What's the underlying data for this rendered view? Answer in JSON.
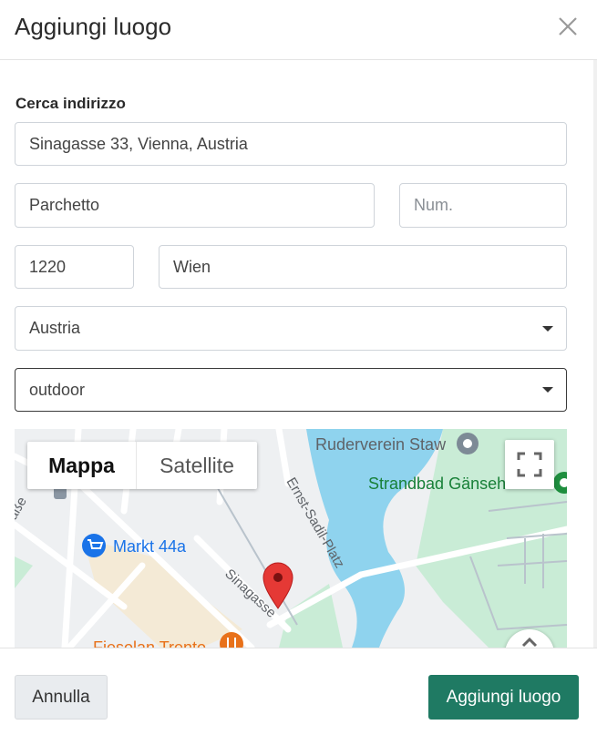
{
  "dialog": {
    "title": "Aggiungi luogo",
    "close_icon": "close-icon"
  },
  "form": {
    "search_label": "Cerca indirizzo",
    "search_value": "Sinagasse 33, Vienna, Austria",
    "street_value": "Parchetto",
    "number_placeholder": "Num.",
    "zip_value": "1220",
    "city_value": "Wien",
    "country_value": "Austria",
    "type_value": "outdoor"
  },
  "map": {
    "map_type_options": [
      "Mappa",
      "Satellite"
    ],
    "selected_map_type": "Mappa",
    "labels": {
      "ruderverein": "Ruderverein Staw",
      "strandbad": "Strandbad Gänsehäufel",
      "markt": "Markt 44a",
      "street_sinagasse": "Sinagasse",
      "street_ernst": "Ernst-Sadil-Platz",
      "street_strasse": "raße",
      "restaurant": "Fiesolan Trento"
    },
    "colors": {
      "water": "#8fd3ee",
      "park": "#c9ecd6",
      "land": "#eef0f2",
      "marker": "#e53935",
      "poi_blue": "#1a73e8",
      "poi_green": "#188038",
      "poi_orange": "#e8711a"
    }
  },
  "footer": {
    "cancel_label": "Annulla",
    "add_label": "Aggiungi luogo"
  }
}
